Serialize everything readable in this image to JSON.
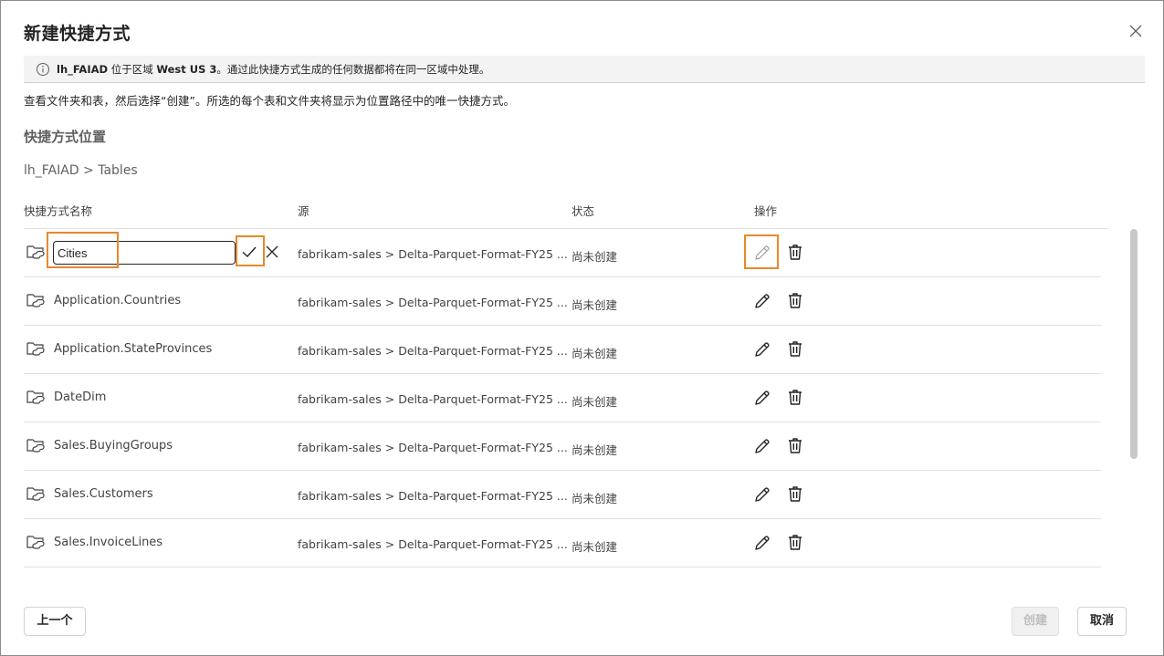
{
  "dialog": {
    "title": "新建快捷方式",
    "info": {
      "lakehouse": "lh_FAIAD",
      "part1": " 位于区域 ",
      "region": "West US 3",
      "part2": "。通过此快捷方式生成的任何数据都将在同一区域中处理。"
    },
    "description": "查看文件夹和表，然后选择“创建”。所选的每个表和文件夹将显示为位置路径中的唯一快捷方式。",
    "section_title": "快捷方式位置",
    "breadcrumb": "lh_FAIAD > Tables",
    "columns": {
      "name": "快捷方式名称",
      "source": "源",
      "status": "状态",
      "actions": "操作"
    },
    "editing_row": {
      "value": "Cities",
      "source": "fabrikam-sales > Delta-Parquet-Format-FY25 ...",
      "status": "尚未创建"
    },
    "rows": [
      {
        "name": "Application.Countries",
        "source": "fabrikam-sales > Delta-Parquet-Format-FY25 ...",
        "status": "尚未创建"
      },
      {
        "name": "Application.StateProvinces",
        "source": "fabrikam-sales > Delta-Parquet-Format-FY25 ...",
        "status": "尚未创建"
      },
      {
        "name": "DateDim",
        "source": "fabrikam-sales > Delta-Parquet-Format-FY25 ...",
        "status": "尚未创建"
      },
      {
        "name": "Sales.BuyingGroups",
        "source": "fabrikam-sales > Delta-Parquet-Format-FY25 ...",
        "status": "尚未创建"
      },
      {
        "name": "Sales.Customers",
        "source": "fabrikam-sales > Delta-Parquet-Format-FY25 ...",
        "status": "尚未创建"
      },
      {
        "name": "Sales.InvoiceLines",
        "source": "fabrikam-sales > Delta-Parquet-Format-FY25 ...",
        "status": "尚未创建"
      }
    ],
    "buttons": {
      "previous": "上一个",
      "create": "创建",
      "cancel": "取消"
    },
    "icons": {
      "close": "close-icon",
      "info": "info-icon",
      "folder": "folder-link-icon",
      "edit": "pencil-icon",
      "delete": "trash-icon",
      "confirm": "checkmark-icon",
      "cancel_edit": "dismiss-icon"
    },
    "colors": {
      "highlight": "#e8882c",
      "infobar_bg": "#f3f3f3",
      "disabled_text": "#bdbdbd"
    }
  }
}
